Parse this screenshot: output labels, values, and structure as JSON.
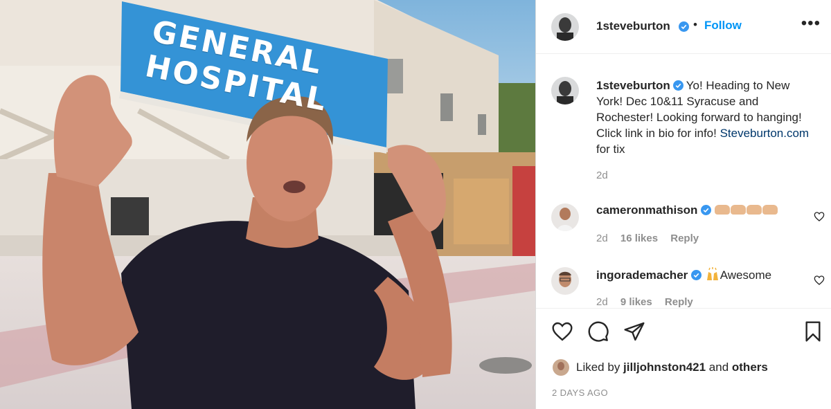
{
  "media": {
    "sign_text": "GENERAL HOSPITAL"
  },
  "header": {
    "username": "1steveburton",
    "separator": "•",
    "follow_label": "Follow",
    "more_label": "•••"
  },
  "caption": {
    "username": "1steveburton",
    "text": "Yo! Heading to New York! Dec 10&11 Syracuse and Rochester! Looking forward to hanging! Click link in bio for info!",
    "link": "Steveburton.com",
    "after_link": " for tix",
    "time": "2d"
  },
  "comments": [
    {
      "username": "cameronmathison",
      "text": "",
      "time": "2d",
      "likes": "16 likes",
      "reply": "Reply",
      "icon": "clapping-hands-emoji"
    },
    {
      "username": "ingorademacher",
      "text": "Awesome",
      "time": "2d",
      "likes": "9 likes",
      "reply": "Reply",
      "icon": "raising-hands-emoji"
    }
  ],
  "likes": {
    "prefix": "Liked by ",
    "user": "jilljohnston421",
    "middle": " and ",
    "suffix": "others"
  },
  "posted": "2 DAYS AGO",
  "colors": {
    "accent": "#0095f6",
    "verified": "#3897f0",
    "link": "#00376b",
    "muted": "#8e8e8e"
  }
}
